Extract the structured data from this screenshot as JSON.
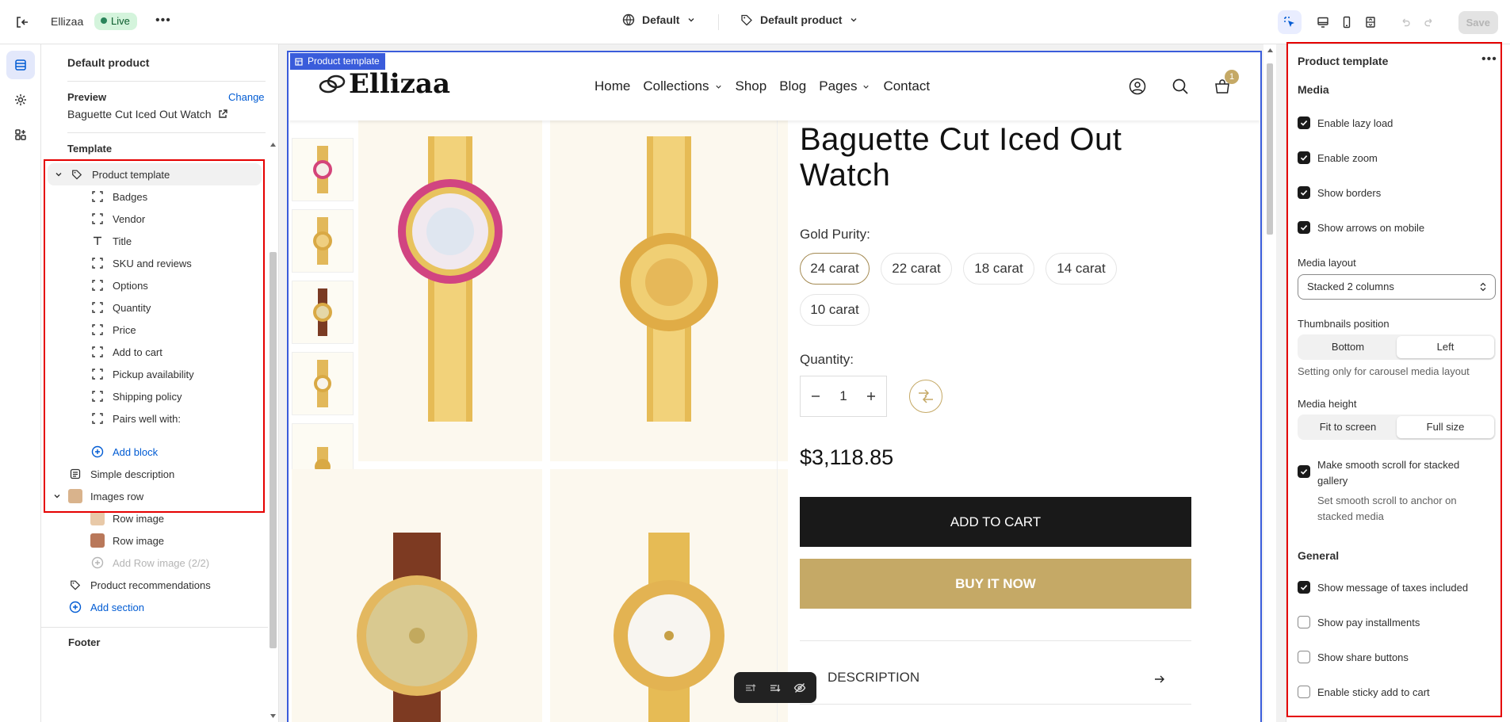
{
  "topbar": {
    "store_name": "Ellizaa",
    "live_badge": "Live",
    "theme_label": "Default",
    "template_label": "Default product",
    "save_label": "Save"
  },
  "sidebar": {
    "title": "Default product",
    "preview_label": "Preview",
    "change_label": "Change",
    "preview_value": "Baguette Cut Iced Out Watch",
    "template_heading": "Template",
    "section_product_template": "Product template",
    "blocks": [
      {
        "label": "Badges",
        "icon": "block-icon"
      },
      {
        "label": "Vendor",
        "icon": "block-icon"
      },
      {
        "label": "Title",
        "icon": "text-icon"
      },
      {
        "label": "SKU and reviews",
        "icon": "block-icon"
      },
      {
        "label": "Options",
        "icon": "block-icon"
      },
      {
        "label": "Quantity",
        "icon": "block-icon"
      },
      {
        "label": "Price",
        "icon": "block-icon"
      },
      {
        "label": "Add to cart",
        "icon": "block-icon"
      },
      {
        "label": "Pickup availability",
        "icon": "block-icon"
      },
      {
        "label": "Shipping policy",
        "icon": "block-icon"
      },
      {
        "label": "Pairs well with:",
        "icon": "block-icon"
      }
    ],
    "add_block": "Add block",
    "simple_description": "Simple description",
    "images_row": "Images row",
    "row_image_1": "Row image",
    "row_image_2": "Row image",
    "add_row_image": "Add Row image (2/2)",
    "product_recommendations": "Product recommendations",
    "add_section": "Add section",
    "footer_partial": "Footer"
  },
  "canvas": {
    "tag": "Product template",
    "logo": "Ellizaa",
    "nav": [
      "Home",
      "Collections",
      "Shop",
      "Blog",
      "Pages",
      "Contact"
    ],
    "cart_count": "1",
    "product_title": "Baguette Cut Iced Out Watch",
    "purity_label": "Gold Purity:",
    "purity_options": [
      "24 carat",
      "22 carat",
      "18 carat",
      "14 carat",
      "10 carat"
    ],
    "purity_selected": "24 carat",
    "quantity_label": "Quantity:",
    "quantity_value": "1",
    "price": "$3,118.85",
    "add_to_cart": "ADD TO CART",
    "buy_now": "BUY IT NOW",
    "description": "DESCRIPTION"
  },
  "settings": {
    "title": "Product template",
    "media_heading": "Media",
    "lazy_load": "Enable lazy load",
    "zoom": "Enable zoom",
    "borders": "Show borders",
    "arrows_mobile": "Show arrows on mobile",
    "media_layout_label": "Media layout",
    "media_layout_value": "Stacked 2 columns",
    "thumbs_pos_label": "Thumbnails position",
    "thumbs_pos_options": [
      "Bottom",
      "Left"
    ],
    "thumbs_pos_help": "Setting only for carousel media layout",
    "media_height_label": "Media height",
    "media_height_options": [
      "Fit to screen",
      "Full size"
    ],
    "smooth_scroll": "Make smooth scroll for stacked gallery",
    "smooth_scroll_help": "Set smooth scroll to anchor on stacked media",
    "general_heading": "General",
    "taxes": "Show message of taxes included",
    "installments": "Show pay installments",
    "share": "Show share buttons",
    "sticky": "Enable sticky add to cart"
  },
  "colors": {
    "accent": "#005bd3",
    "selection_outline": "#3a5cdb",
    "highlight": "#e50000",
    "gold": "#c5a966"
  }
}
